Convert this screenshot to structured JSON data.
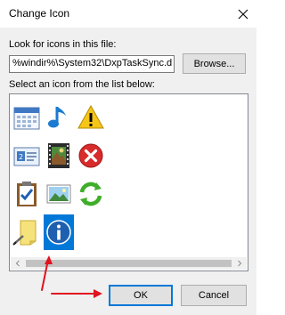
{
  "window": {
    "title": "Change Icon"
  },
  "file": {
    "label": "Look for icons in this file:",
    "value": "%windir%\\System32\\DxpTaskSync.d",
    "browse_label": "Browse..."
  },
  "icons": {
    "label": "Select an icon from the list below:",
    "items": [
      "calendar-icon",
      "music-note-icon",
      "warning-icon",
      "contact-card-icon",
      "film-strip-icon",
      "error-icon",
      "task-clipboard-icon",
      "picture-icon",
      "sync-arrows-icon",
      "note-pad-icon",
      "info-icon"
    ],
    "selected": "info-icon"
  },
  "buttons": {
    "ok_label": "OK",
    "cancel_label": "Cancel"
  },
  "colors": {
    "accent": "#0078d7",
    "annotation": "#e0141e"
  }
}
